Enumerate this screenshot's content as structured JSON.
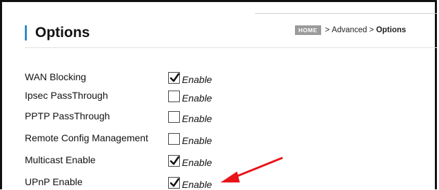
{
  "page": {
    "title": "Options",
    "breadcrumb": {
      "home_badge": "HOME",
      "separator1": ">",
      "section": "Advanced",
      "separator2": ">",
      "current": "Options"
    }
  },
  "options": [
    {
      "label": "WAN Blocking",
      "checked": true,
      "checkbox_text": "Enable"
    },
    {
      "label": "Ipsec PassThrough",
      "checked": false,
      "checkbox_text": "Enable"
    },
    {
      "label": "PPTP PassThrough",
      "checked": false,
      "checkbox_text": "Enable"
    },
    {
      "label": "Remote Config Management",
      "checked": false,
      "checkbox_text": "Enable"
    },
    {
      "label": "Multicast Enable",
      "checked": true,
      "checkbox_text": "Enable"
    },
    {
      "label": "UPnP Enable",
      "checked": true,
      "checkbox_text": "Enable"
    }
  ],
  "colors": {
    "accent": "#2d8fc9",
    "annotation_arrow": "#e8141a",
    "home_badge_bg": "#9a9a9a"
  },
  "icons": {
    "check": "checkmark-icon",
    "arrow": "red-arrow-annotation"
  }
}
